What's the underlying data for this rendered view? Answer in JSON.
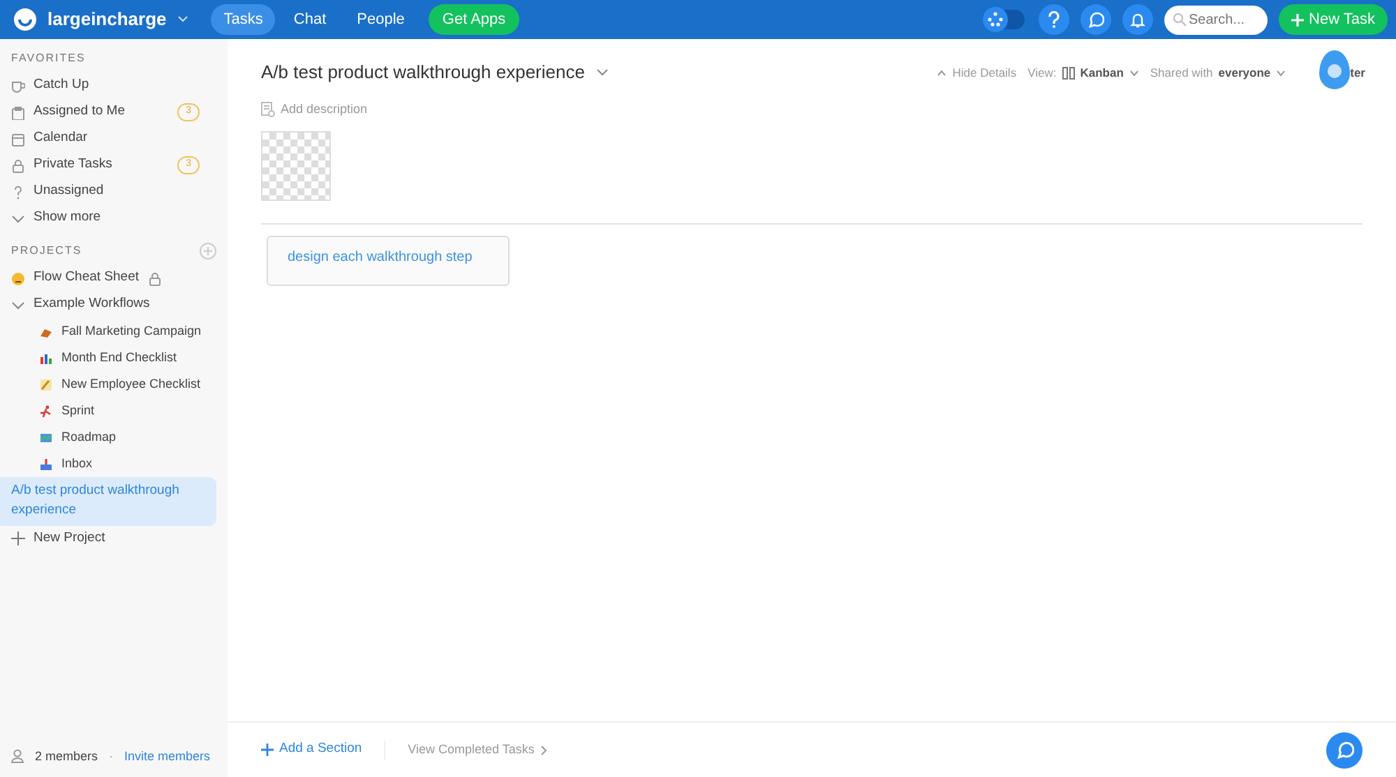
{
  "topbar": {
    "workspace": "largeincharge",
    "tabs": [
      {
        "label": "Tasks",
        "selected": true
      },
      {
        "label": "Chat",
        "selected": false
      },
      {
        "label": "People",
        "selected": false
      }
    ],
    "get_apps": "Get Apps",
    "search": {
      "placeholder": "Search..."
    },
    "new_task": "New Task"
  },
  "sidebar": {
    "favorites_heading": "FAVORITES",
    "favorites": [
      {
        "label": "Catch Up"
      },
      {
        "label": "Assigned to Me",
        "count": "3"
      },
      {
        "label": "Calendar"
      },
      {
        "label": "Private Tasks",
        "count": "3"
      },
      {
        "label": "Unassigned"
      },
      {
        "label": "Show more"
      }
    ],
    "projects_heading": "PROJECTS",
    "projects": [
      {
        "label": "Flow Cheat Sheet",
        "locked": true,
        "selected": false
      },
      {
        "label": "Example Workflows",
        "expanded": true,
        "selected": false,
        "children": [
          {
            "label": "Fall Marketing Campaign"
          },
          {
            "label": "Month End Checklist"
          },
          {
            "label": "New Employee Checklist"
          },
          {
            "label": "Sprint"
          },
          {
            "label": "Roadmap"
          },
          {
            "label": "Inbox"
          }
        ]
      },
      {
        "label": "A/b test product walkthrough experience",
        "selected": true
      }
    ],
    "new_project": "New Project",
    "members": "2 members",
    "separator": "·",
    "invite": "Invite members"
  },
  "main": {
    "title": "A/b test product walkthrough experience",
    "hide_details": "Hide Details",
    "view_label": "View:",
    "view_value": "Kanban",
    "shared_label": "Shared with",
    "shared_value": "everyone",
    "filter_partial": "ter",
    "add_description": "Add description",
    "cards": [
      "design each walkthrough step"
    ],
    "add_section": "Add a Section",
    "view_completed": "View Completed Tasks"
  }
}
